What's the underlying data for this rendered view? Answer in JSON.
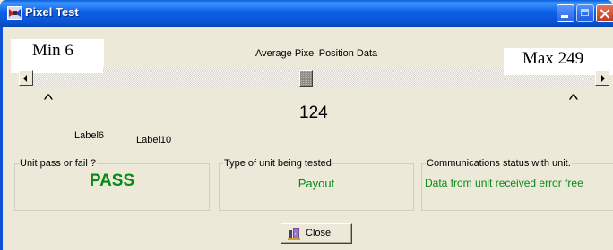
{
  "window": {
    "title": "Pixel Test",
    "icon": "app-icon",
    "controls": [
      "minimize-icon",
      "maximize-icon",
      "close-window-icon"
    ]
  },
  "slider": {
    "min_label": "Min 6",
    "max_label": "Max 249",
    "caption": "Average Pixel Position Data",
    "min": 6,
    "max": 249,
    "value": 124,
    "value_text": "124",
    "caret_left": "^",
    "caret_right": "^"
  },
  "labels": {
    "label6": "Label6",
    "label10": "Label10"
  },
  "groups": {
    "pass": {
      "legend": "Unit pass or fail ?",
      "value": "PASS"
    },
    "unit": {
      "legend": "Type of unit being tested",
      "value": "Payout"
    },
    "comm": {
      "legend": "Communications status with unit.",
      "value": "Data from unit received error free"
    }
  },
  "close_button": {
    "mnemonic": "C",
    "rest": "lose",
    "icon": "door-exit-icon"
  },
  "colors": {
    "title_bar": "#0a55d6",
    "face": "#ece9d8",
    "status_green": "#078a17"
  }
}
